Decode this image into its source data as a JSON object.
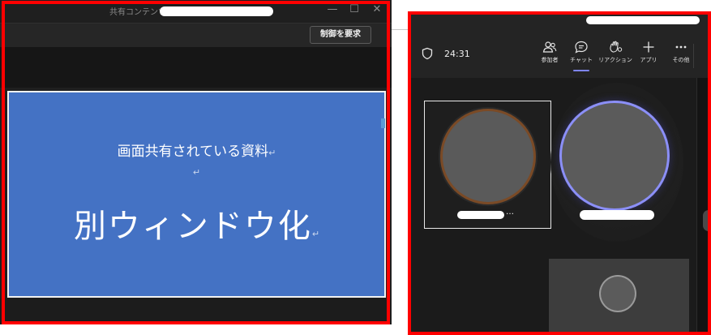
{
  "shared_window": {
    "title": "共有コンテンツ",
    "window_controls": {
      "minimize": "—",
      "maximize": "☐",
      "close": "✕"
    },
    "request_control_label": "制御を要求",
    "slide": {
      "subtitle": "画面共有されている資料",
      "title": "別ウィンドウ化",
      "paragraph_mark": "↵",
      "background_color": "#4472c4"
    }
  },
  "meeting_window": {
    "timer": "24:31",
    "toolbar": [
      {
        "label": "参加者",
        "icon": "people-icon"
      },
      {
        "label": "チャット",
        "icon": "chat-icon",
        "active": true
      },
      {
        "label": "リアクション",
        "icon": "reaction-icon"
      },
      {
        "label": "アプリ",
        "icon": "plus-icon"
      },
      {
        "label": "その他",
        "icon": "more-icon"
      }
    ],
    "participants": [
      {
        "name_suffix": "…"
      }
    ],
    "accent_color": "#7f85f5",
    "highlight_color": "#ff0000"
  }
}
